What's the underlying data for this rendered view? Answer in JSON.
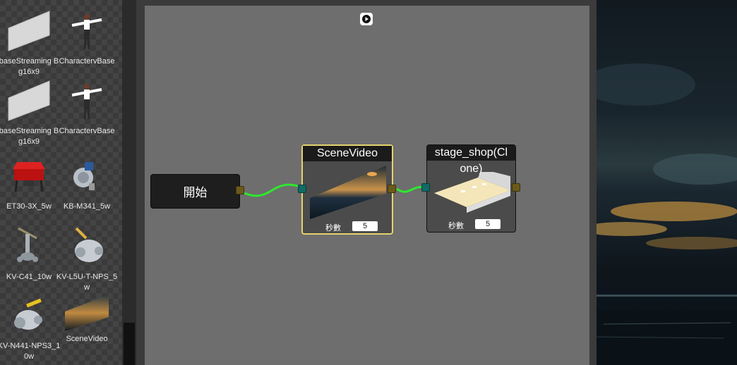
{
  "assets": [
    {
      "label": "baseStreaming Bg16x9",
      "icon": "plane-icon"
    },
    {
      "label": "CharactervBase",
      "icon": "character-icon"
    },
    {
      "label": "baseStreaming Bg16x9",
      "icon": "plane-icon"
    },
    {
      "label": "CharactervBase",
      "icon": "character-icon"
    },
    {
      "label": "ET30-3X_5w",
      "icon": "red-machine-icon"
    },
    {
      "label": "KB-M341_5w",
      "icon": "valve-icon"
    },
    {
      "label": "KV-C41_10w",
      "icon": "valve-stand-icon"
    },
    {
      "label": "KV-L5U-T-NPS_5w",
      "icon": "ball-valve-icon"
    },
    {
      "label": "KV-N441-NPS3_10w",
      "icon": "ball-valve-yellow-icon"
    },
    {
      "label": "SceneVideo",
      "icon": "scene-video-thumb-icon"
    }
  ],
  "graph": {
    "start_node": {
      "title": "開始"
    },
    "scene_node": {
      "title": "SceneVideo",
      "param_label": "秒數",
      "param_value": "5"
    },
    "stage_node": {
      "title_line1": "stage_shop(Cl",
      "title_line2": "one)",
      "param_label": "秒數",
      "param_value": "5"
    }
  },
  "colors": {
    "wire": "#2ee82e",
    "selected_border": "#e6d36a",
    "canvas": "#6e6e6e"
  }
}
